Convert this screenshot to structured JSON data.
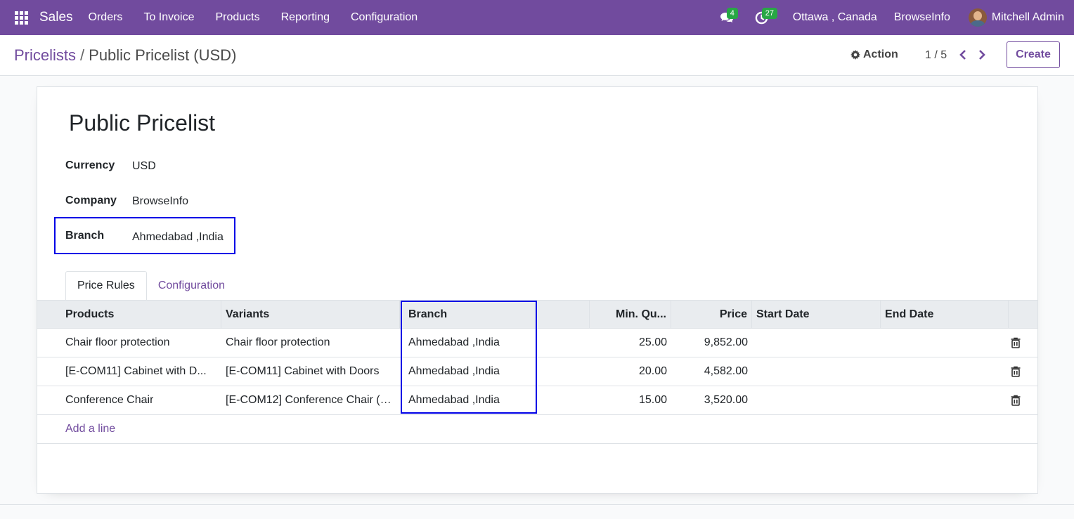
{
  "navbar": {
    "app_name": "Sales",
    "menu": [
      "Orders",
      "To Invoice",
      "Products",
      "Reporting",
      "Configuration"
    ],
    "messages_count": "4",
    "activities_count": "27",
    "location": "Ottawa , Canada",
    "company": "BrowseInfo",
    "user": "Mitchell Admin"
  },
  "control_panel": {
    "breadcrumb_parent": "Pricelists",
    "breadcrumb_separator": "/",
    "breadcrumb_current": "Public Pricelist (USD)",
    "action_label": "Action",
    "pager": "1 / 5",
    "create_label": "Create"
  },
  "form": {
    "title": "Public Pricelist",
    "fields": {
      "currency": {
        "label": "Currency",
        "value": "USD"
      },
      "company": {
        "label": "Company",
        "value": "BrowseInfo"
      },
      "branch": {
        "label": "Branch",
        "value": "Ahmedabad ,India"
      }
    },
    "tabs": [
      "Price Rules",
      "Configuration"
    ],
    "table": {
      "columns": [
        "Products",
        "Variants",
        "Branch",
        "Min. Qu...",
        "Price",
        "Start Date",
        "End Date"
      ],
      "rows": [
        {
          "product": "Chair floor protection",
          "variant": "Chair floor protection",
          "branch": "Ahmedabad ,India",
          "min_qty": "25.00",
          "price": "9,852.00",
          "start": "",
          "end": ""
        },
        {
          "product": "[E-COM11] Cabinet with D...",
          "variant": "[E-COM11] Cabinet with Doors",
          "branch": "Ahmedabad ,India",
          "min_qty": "20.00",
          "price": "4,582.00",
          "start": "",
          "end": ""
        },
        {
          "product": "Conference Chair",
          "variant": "[E-COM12] Conference Chair (St...",
          "branch": "Ahmedabad ,India",
          "min_qty": "15.00",
          "price": "3,520.00",
          "start": "",
          "end": ""
        }
      ],
      "add_line_label": "Add a line"
    }
  },
  "colors": {
    "brand": "#714b9e",
    "badge": "#28a745",
    "highlight": "#0000e6"
  }
}
